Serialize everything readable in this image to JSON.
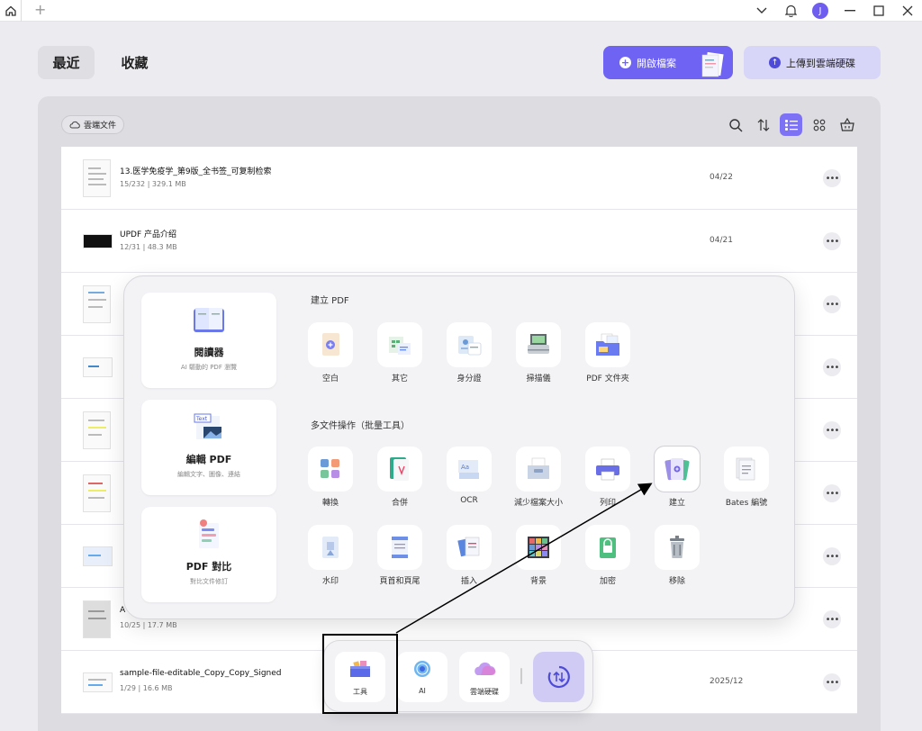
{
  "header": {
    "tab_recent": "最近",
    "tab_favorites": "收藏",
    "open_file": "開啟檔案",
    "upload_cloud": "上傳到雲端硬碟"
  },
  "user": {
    "avatar_initial": "J"
  },
  "main": {
    "cloud_docs": "雲端文件"
  },
  "files": [
    {
      "name": "13.医学免疫学_第9版_全书签_可复制检索",
      "meta": "15/232 | 329.1 MB",
      "date": "04/22"
    },
    {
      "name": "UPDF 产品介绍",
      "meta": "12/31 | 48.3 MB",
      "date": "04/21"
    },
    {
      "name": "",
      "meta": "",
      "date": ""
    },
    {
      "name": "",
      "meta": "",
      "date": ""
    },
    {
      "name": "",
      "meta": "",
      "date": ""
    },
    {
      "name": "",
      "meta": "",
      "date": ""
    },
    {
      "name": "",
      "meta": "",
      "date": ""
    },
    {
      "name": "A",
      "meta": "10/25 | 17.7 MB",
      "date": ""
    },
    {
      "name": "sample-file-editable_Copy_Copy_Signed",
      "meta": "1/29 | 16.6 MB",
      "date": "2025/12"
    }
  ],
  "popup": {
    "modes": [
      {
        "title": "閱讀器",
        "subtitle": "AI 驅動的 PDF 瀏覽"
      },
      {
        "title": "編輯 PDF",
        "subtitle": "編輯文字、圖像、連結"
      },
      {
        "title": "PDF 對比",
        "subtitle": "對比文件修訂"
      }
    ],
    "create_title": "建立 PDF",
    "create_tools": [
      "空白",
      "其它",
      "身分證",
      "掃描儀",
      "PDF 文件夾"
    ],
    "batch_title": "多文件操作（批量工具）",
    "batch_tools_row1": [
      "轉換",
      "合併",
      "OCR",
      "減少檔案大小",
      "列印",
      "建立",
      "Bates 編號"
    ],
    "batch_tools_row2": [
      "水印",
      "頁首和頁尾",
      "插入",
      "背景",
      "加密",
      "移除"
    ]
  },
  "dock": {
    "tools": "工具",
    "ai": "AI",
    "cloud": "雲端硬碟"
  },
  "colors": {
    "accent": "#6e63f2",
    "accent_light": "#d8d6f8",
    "background": "#ececf0"
  }
}
